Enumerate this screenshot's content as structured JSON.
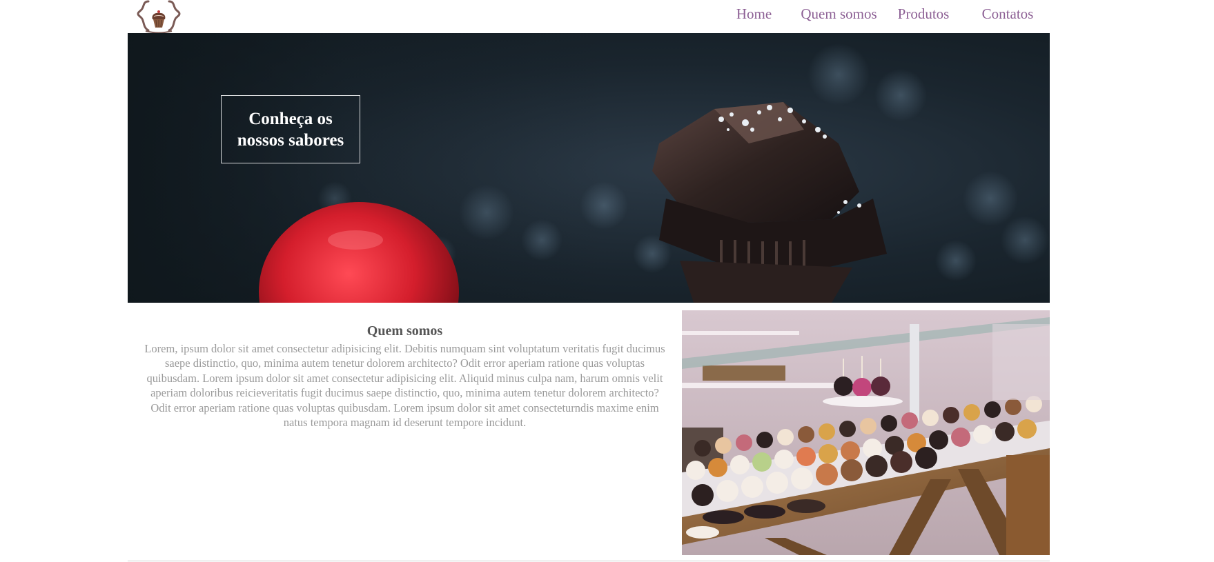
{
  "nav": {
    "items": [
      {
        "label": "Home"
      },
      {
        "label": "Quem somos"
      },
      {
        "label": "Produtos"
      },
      {
        "label": "Contatos"
      }
    ]
  },
  "hero": {
    "title": "Conheça os nossos sabores"
  },
  "about": {
    "title": "Quem somos",
    "text": "Lorem, ipsum dolor sit amet consectetur adipisicing elit. Debitis numquam sint voluptatum veritatis fugit ducimus saepe distinctio, quo, minima autem tenetur dolorem architecto? Odit error aperiam ratione quas voluptas quibusdam. Lorem ipsum dolor sit amet consectetur adipisicing elit. Aliquid minus culpa nam, harum omnis velit aperiam doloribus reicieveritatis fugit ducimus saepe distinctio, quo, minima autem tenetur dolorem architecto? Odit error aperiam ratione quas voluptas quibusdam. Lorem ipsum dolor sit amet consecteturndis maxime enim natus tempora magnam id deserunt tempore incidunt."
  },
  "colors": {
    "nav_link": "#8c5f94",
    "heading": "#555555",
    "body_text": "#9a9a9a",
    "hero_background": "#1a252e"
  },
  "icons": {
    "logo": "cupcake-logo-icon"
  },
  "images": {
    "hero": "chocolate-and-strawberry-photo",
    "shop": "pastry-display-case-photo"
  }
}
